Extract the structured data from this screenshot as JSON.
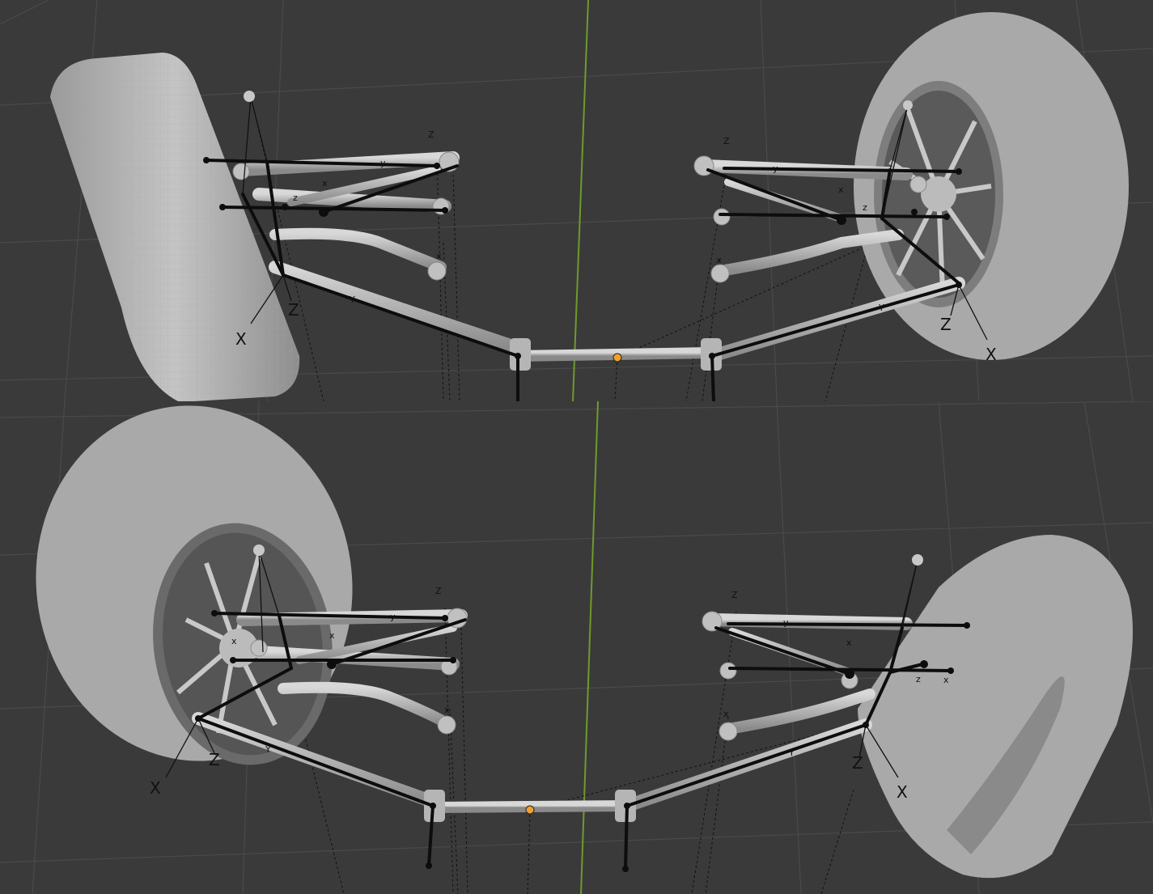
{
  "viewports": [
    {
      "id": "top",
      "labels": [
        "X",
        "Y",
        "Z",
        "x",
        "y",
        "z"
      ]
    },
    {
      "id": "bottom",
      "labels": [
        "X",
        "Y",
        "Z",
        "x",
        "y",
        "z"
      ]
    }
  ],
  "axis_labels": {
    "x_big": "X",
    "y_big": "Y",
    "z_big": "Z",
    "x_small": "x",
    "y_small": "y",
    "z_small": "z"
  },
  "colors": {
    "background": "#3a3a3a",
    "grid": "#4a4a4a",
    "y_axis_line": "#6f9a2c",
    "mesh": "#bdbdbd",
    "mesh_dark": "#8c8c8c",
    "bone": "#0d0d0d",
    "origin": "#f0a030"
  }
}
